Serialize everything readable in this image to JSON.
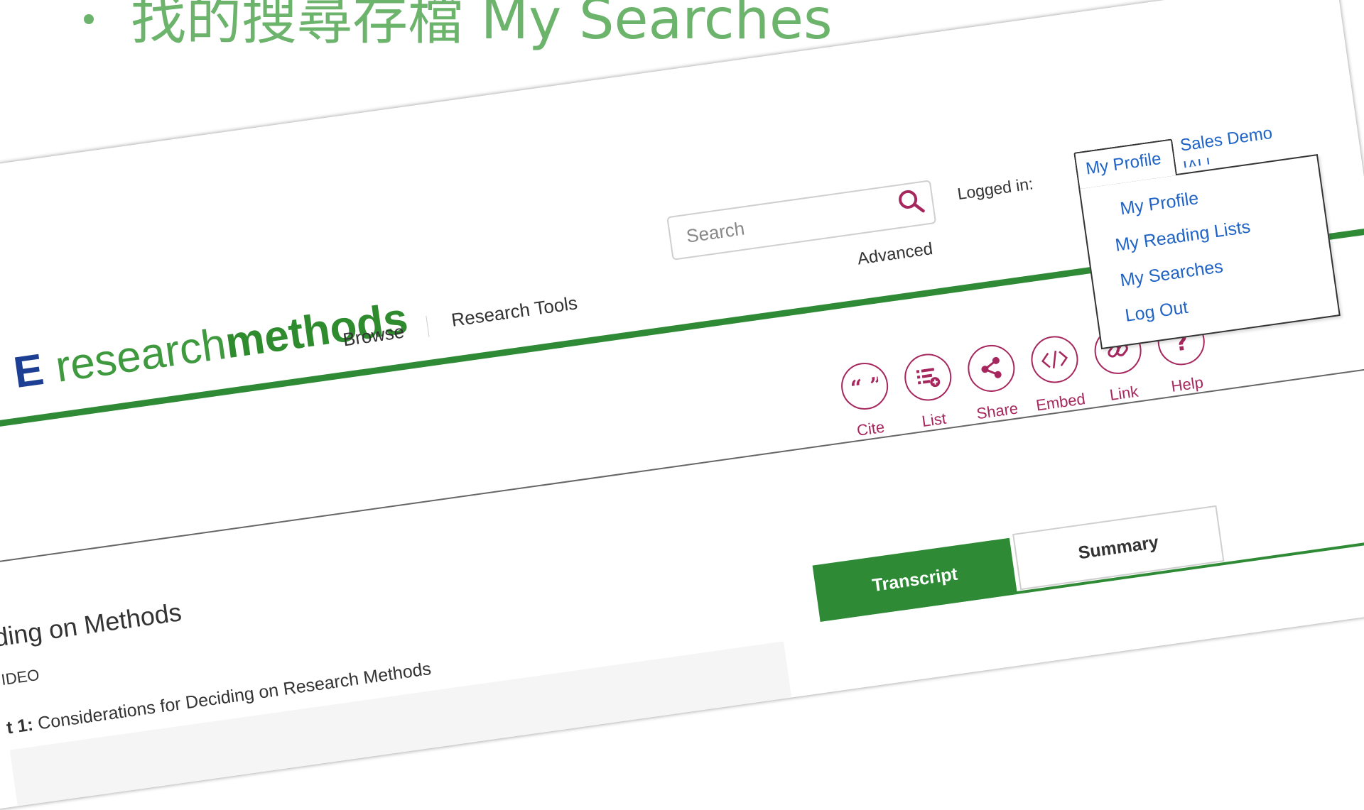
{
  "slide": {
    "title": "找的搜尋存檔 My Searches"
  },
  "logo": {
    "prefix": "E",
    "light": "research",
    "bold": "methods"
  },
  "nav": {
    "browse": "Browse",
    "research_tools": "Research Tools"
  },
  "search": {
    "placeholder": "Search",
    "advanced": "Advanced"
  },
  "account": {
    "logged_in_label": "Logged in:",
    "profile_tab": "My Profile",
    "org_name": "Sales Demo",
    "org_sub": "IALL",
    "menu": [
      "My Profile",
      "My Reading Lists",
      "My Searches",
      "Log Out"
    ]
  },
  "tools": [
    {
      "label": "Cite",
      "icon": "quote-icon"
    },
    {
      "label": "List",
      "icon": "list-add-icon"
    },
    {
      "label": "Share",
      "icon": "share-icon"
    },
    {
      "label": "Embed",
      "icon": "code-icon"
    },
    {
      "label": "Link",
      "icon": "link-icon"
    },
    {
      "label": "Help",
      "icon": "help-icon"
    }
  ],
  "page": {
    "heading": "ding on Methods",
    "media_type": "IDEO",
    "clip_prefix": "t 1:",
    "clip_title": " Considerations for Deciding on Research Methods"
  },
  "tabs": {
    "transcript": "Transcript",
    "summary": "Summary"
  },
  "colors": {
    "brand_green": "#2f8a36",
    "accent_maroon": "#a6275d",
    "link_blue": "#1f63c6",
    "slide_green": "#6cb36c"
  }
}
